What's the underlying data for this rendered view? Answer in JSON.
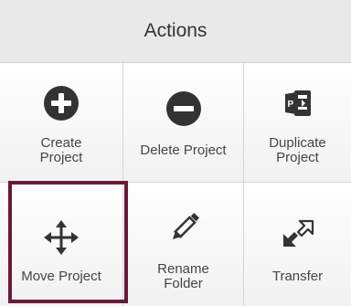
{
  "header": {
    "title": "Actions"
  },
  "colors": {
    "selection_border": "#6b1839",
    "icon": "#333333",
    "header_bg": "#e9e9e9"
  },
  "actions": [
    {
      "label": "Create Project",
      "icon": "plus-circle-icon"
    },
    {
      "label": "Delete Project",
      "icon": "minus-circle-icon"
    },
    {
      "label": "Duplicate Project",
      "icon": "duplicate-document-icon"
    },
    {
      "label": "Move Project",
      "icon": "move-arrows-icon",
      "selected": true
    },
    {
      "label": "Rename Folder",
      "icon": "pencil-icon"
    },
    {
      "label": "Transfer",
      "icon": "transfer-arrows-icon"
    }
  ],
  "labels_wrapped": {
    "create": [
      "Create",
      "Project"
    ],
    "duplicate": [
      "Duplicate",
      "Project"
    ],
    "rename": [
      "Rename",
      "Folder"
    ]
  }
}
